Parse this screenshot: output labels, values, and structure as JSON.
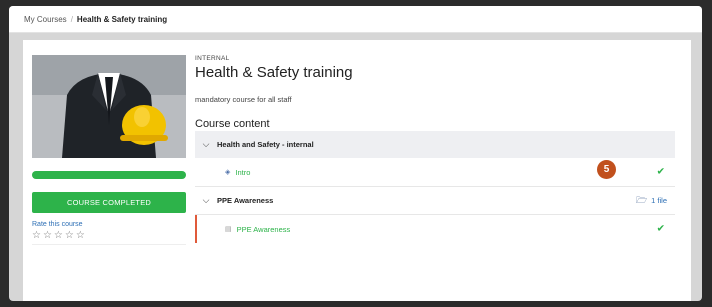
{
  "breadcrumb": {
    "parent": "My Courses",
    "separator": "/",
    "current": "Health & Safety training"
  },
  "sidebar": {
    "progress_percent": 100,
    "completed_label": "COURSE COMPLETED",
    "rate_label": "Rate this course",
    "stars": "☆☆☆☆☆",
    "star_count": 5,
    "rating_value": 0
  },
  "course": {
    "tag": "INTERNAL",
    "title": "Health & Safety training",
    "description": "mandatory course for all staff",
    "content_heading": "Course content",
    "sections": [
      {
        "title": "Health and Safety - internal",
        "items": [
          {
            "label": "Intro",
            "icon": "package-icon",
            "completed": true
          }
        ]
      },
      {
        "title": "PPE Awareness",
        "files": "1 file",
        "items": [
          {
            "label": "PPE Awareness",
            "icon": "pdf-icon",
            "completed": true
          }
        ]
      }
    ]
  },
  "annotation": {
    "badge_number": "5"
  },
  "colors": {
    "success": "#2db34a",
    "link": "#2d6fb5",
    "badge": "#c1501d",
    "active_bar": "#e05a3a"
  }
}
